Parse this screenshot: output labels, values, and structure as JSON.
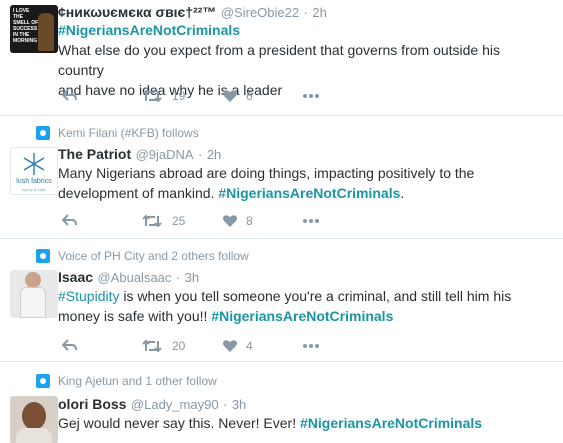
{
  "tweets": [
    {
      "name": "¢ниκωυємєкα σвιє†²²™",
      "handle": "@SireObie22",
      "dot": "·",
      "time": "2h",
      "hashtag": "#NigeriansAreNotCriminals",
      "line1": "What else do you expect from a president that governs from outside his country",
      "line2": "and have no idea why he is a leader",
      "retweets": "19",
      "likes": "6",
      "avatar_text": "I LOVE THE SMELL OF SUCCESS IN THE MORNING"
    },
    {
      "follow": "Kemi Filani (#KFB) follows",
      "name": "The Patriot",
      "handle": "@9jaDNA",
      "dot": "·",
      "time": "2h",
      "line1": "Many Nigerians abroad are doing things, impacting positively to the",
      "line2_prefix": "development of mankind.",
      "hashtag": "#NigeriansAreNotCriminals",
      "line2_suffix": ".",
      "retweets": "25",
      "likes": "8",
      "avatar_brand": "lush fabrics",
      "avatar_sub": "luxury & style"
    },
    {
      "follow": "Voice of PH City and 2 others follow",
      "name": "Isaac",
      "handle": "@Abualsaac",
      "dot": "·",
      "time": "3h",
      "hashtag1": "#Stupidity",
      "line1_rest": "is when you tell someone you're a criminal, and still tell him his",
      "line2_prefix": "money is safe with you!!",
      "hashtag2": "#NigeriansAreNotCriminals",
      "retweets": "20",
      "likes": "4"
    },
    {
      "follow": "King Ajetun and 1 other follow",
      "name": "olori Boss",
      "handle": "@Lady_may90",
      "dot": "·",
      "time": "3h",
      "line1_prefix": "Gej would never say this. Never! Ever!",
      "hashtag": "#NigeriansAreNotCriminals"
    }
  ],
  "colors": {
    "hashtag": "#1b95a5",
    "meta": "#8899a6",
    "text": "#292f33",
    "follow_badge": "#1da1f2"
  },
  "icons": [
    "reply-icon",
    "retweet-icon",
    "heart-icon",
    "more-icon",
    "follow-badge-icon"
  ]
}
